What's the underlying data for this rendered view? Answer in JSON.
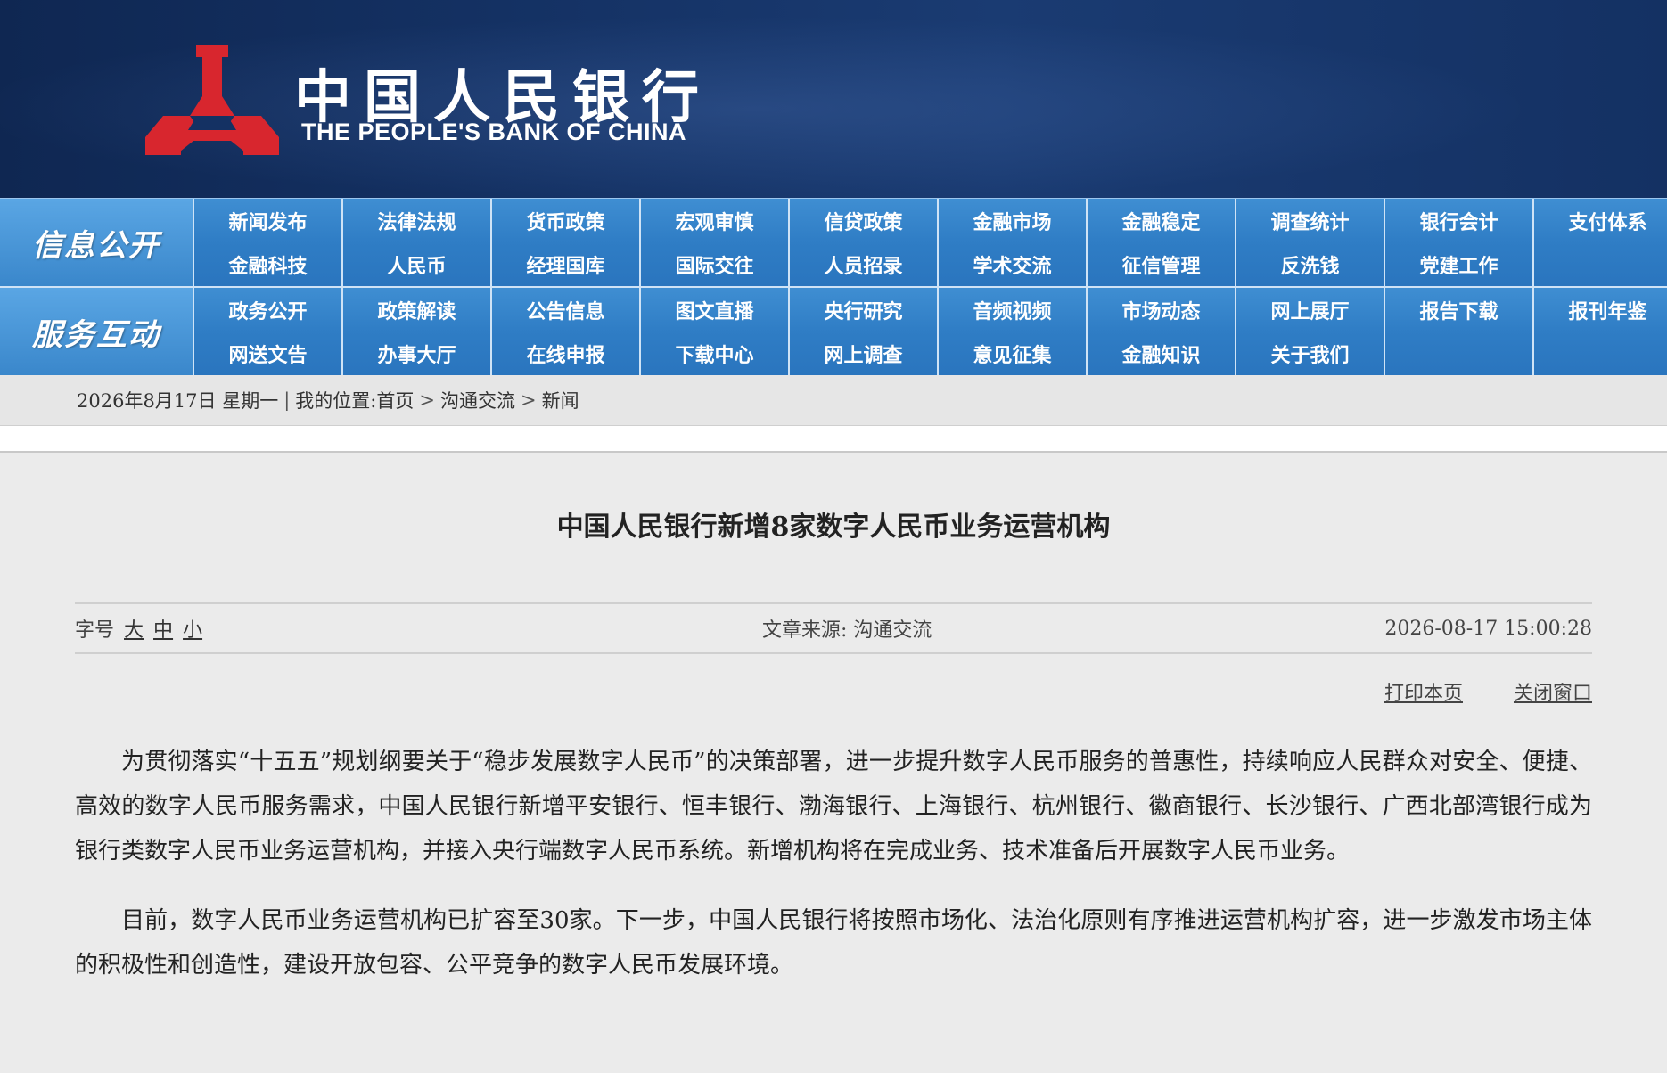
{
  "header": {
    "logo_cn": "中国人民银行",
    "logo_en": "THE PEOPLE'S BANK OF CHINA",
    "brand_red": "#d8262e",
    "logo_icon": "pboc-emblem-icon"
  },
  "nav": {
    "info_title": "信息公开",
    "info_items": [
      "新闻发布",
      "法律法规",
      "货币政策",
      "宏观审慎",
      "信贷政策",
      "金融市场",
      "金融稳定",
      "调查统计",
      "银行会计",
      "支付体系",
      "金融科技",
      "人民币",
      "经理国库",
      "国际交往",
      "人员招录",
      "学术交流",
      "征信管理",
      "反洗钱",
      "党建工作",
      ""
    ],
    "service_title": "服务互动",
    "service_items": [
      "政务公开",
      "政策解读",
      "公告信息",
      "图文直播",
      "央行研究",
      "音频视频",
      "市场动态",
      "网上展厅",
      "报告下载",
      "报刊年鉴",
      "网送文告",
      "办事大厅",
      "在线申报",
      "下载中心",
      "网上调查",
      "意见征集",
      "金融知识",
      "关于我们",
      "",
      ""
    ]
  },
  "breadcrumb": {
    "date": "2026年8月17日 星期一",
    "divider": "|",
    "location_label": "我的位置:",
    "home": "首页",
    "arrow": ">",
    "section": "沟通交流",
    "page": "新闻"
  },
  "article": {
    "title": "中国人民银行新增8家数字人民币业务运营机构",
    "font_size_label": "字号",
    "font_large": "大",
    "font_medium": "中",
    "font_small": "小",
    "source_label": "文章来源:",
    "source": "沟通交流",
    "datetime": "2026-08-17 15:00:28",
    "print_label": "打印本页",
    "close_label": "关闭窗口",
    "paragraphs": [
      "为贯彻落实“十五五”规划纲要关于“稳步发展数字人民币”的决策部署，进一步提升数字人民币服务的普惠性，持续响应人民群众对安全、便捷、高效的数字人民币服务需求，中国人民银行新增平安银行、恒丰银行、渤海银行、上海银行、杭州银行、徽商银行、长沙银行、广西北部湾银行成为银行类数字人民币业务运营机构，并接入央行端数字人民币系统。新增机构将在完成业务、技术准备后开展数字人民币业务。",
      "目前，数字人民币业务运营机构已扩容至30家。下一步，中国人民银行将按照市场化、法治化原则有序推进运营机构扩容，进一步激发市场主体的积极性和创造性，建设开放包容、公平竞争的数字人民币发展环境。"
    ]
  }
}
